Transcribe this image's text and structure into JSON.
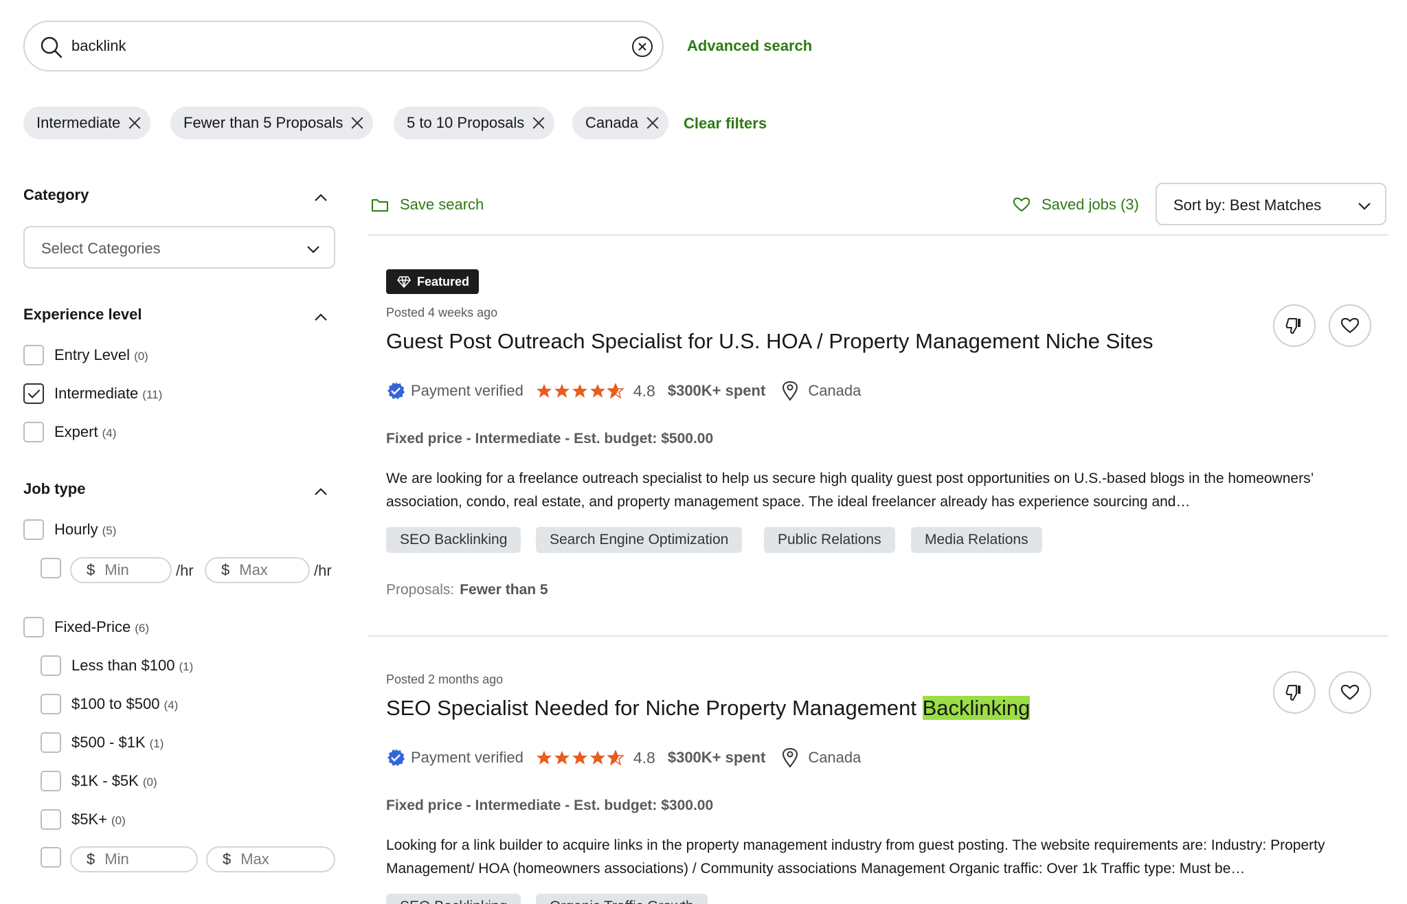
{
  "search": {
    "value": "backlink",
    "advanced_label": "Advanced search"
  },
  "filters": {
    "chips": [
      "Intermediate",
      "Fewer than 5 Proposals",
      "5 to 10 Proposals",
      "Canada"
    ],
    "clear_label": "Clear filters"
  },
  "sidebar": {
    "category": {
      "heading": "Category",
      "select_placeholder": "Select Categories"
    },
    "experience": {
      "heading": "Experience level",
      "options": [
        {
          "label": "Entry Level",
          "count": "(0)",
          "checked": false
        },
        {
          "label": "Intermediate",
          "count": "(11)",
          "checked": true
        },
        {
          "label": "Expert",
          "count": "(4)",
          "checked": false
        }
      ]
    },
    "job_type": {
      "heading": "Job type",
      "hourly": {
        "label": "Hourly",
        "count": "(5)"
      },
      "min_placeholder": "Min",
      "max_placeholder": "Max",
      "currency": "$",
      "per_hour": "/hr",
      "fixed": {
        "label": "Fixed-Price",
        "count": "(6)"
      },
      "fixed_options": [
        {
          "label": "Less than $100",
          "count": "(1)"
        },
        {
          "label": "$100 to $500",
          "count": "(4)"
        },
        {
          "label": "$500 - $1K",
          "count": "(1)"
        },
        {
          "label": "$1K - $5K",
          "count": "(0)"
        },
        {
          "label": "$5K+",
          "count": "(0)"
        }
      ]
    }
  },
  "toolbar": {
    "save_search": "Save search",
    "saved_jobs": "Saved jobs (3)",
    "sort": "Sort by: Best Matches"
  },
  "jobs": [
    {
      "badge": "Featured",
      "posted": "Posted 4 weeks ago",
      "title": "Guest Post Outreach Specialist for U.S. HOA / Property Management Niche Sites",
      "payment": "Payment verified",
      "rating": "4.8",
      "spent": "$300K+ spent",
      "location": "Canada",
      "terms": "Fixed price - Intermediate - Est. budget: $500.00",
      "description": "We are looking for a freelance outreach specialist to help us secure high quality guest post opportunities on U.S.-based blogs in the homeowners’ association, condo, real estate, and property management space. The ideal freelancer already has experience sourcing and…",
      "skills": [
        "SEO Backlinking",
        "Search Engine Optimization",
        "Public Relations",
        "Media Relations"
      ],
      "proposals_label": "Proposals:",
      "proposals_value": "Fewer than 5"
    },
    {
      "posted": "Posted 2 months ago",
      "title_prefix": "SEO Specialist Needed for Niche Property Management",
      "title_highlight": "Backlinking",
      "payment": "Payment verified",
      "rating": "4.8",
      "spent": "$300K+ spent",
      "location": "Canada",
      "terms": "Fixed price - Intermediate - Est. budget: $300.00",
      "description": "Looking for a link builder to acquire links in the property management industry from guest posting. The website requirements are: Industry: Property Management/ HOA (homeowners associations) / Community associations Management Organic traffic: Over 1k Traffic type: Must be…",
      "skills": [
        "SEO Backlinking",
        "Organic Traffic Growth"
      ]
    }
  ],
  "colors": {
    "accent_green": "#2d7a14",
    "highlight": "#9bde45",
    "star": "#e85d1f",
    "verified_blue": "#3465d8"
  }
}
